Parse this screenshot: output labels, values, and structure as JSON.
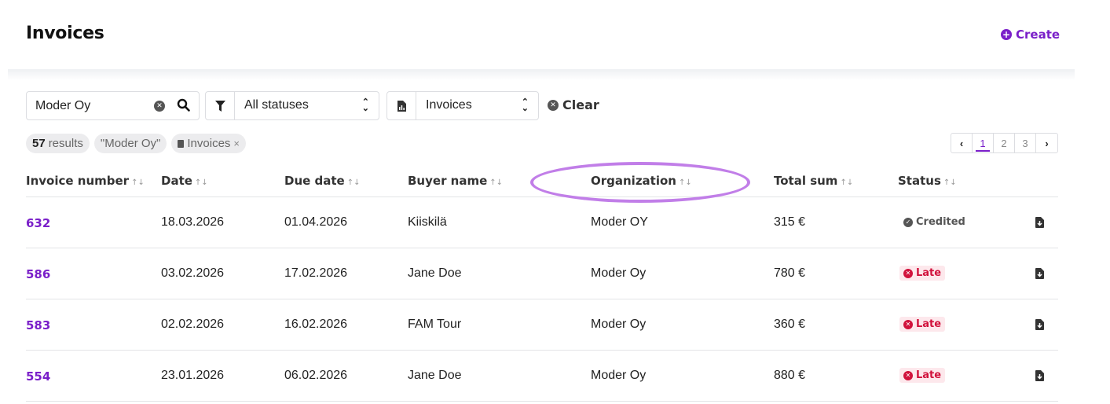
{
  "header": {
    "title": "Invoices",
    "create_label": "Create"
  },
  "search": {
    "value": "Moder Oy",
    "placeholder": ""
  },
  "filters": {
    "status_value": "All statuses",
    "type_value": "Invoices",
    "clear_label": "Clear"
  },
  "results": {
    "count": "57",
    "count_suffix": "results",
    "chip_query": "\"Moder Oy\"",
    "chip_type": "Invoices"
  },
  "pagination": {
    "prev": "‹",
    "pages": [
      "1",
      "2",
      "3"
    ],
    "next": "›",
    "active_page": "1"
  },
  "table": {
    "columns": [
      "Invoice number",
      "Date",
      "Due date",
      "Buyer name",
      "Organization",
      "Total sum",
      "Status"
    ],
    "rows": [
      {
        "number": "632",
        "date": "18.03.2026",
        "due": "01.04.2026",
        "buyer": "Kiiskilä",
        "org": "Moder OY",
        "total": "315 €",
        "status": "Credited"
      },
      {
        "number": "586",
        "date": "03.02.2026",
        "due": "17.02.2026",
        "buyer": "Jane Doe",
        "org": "Moder Oy",
        "total": "780 €",
        "status": "Late"
      },
      {
        "number": "583",
        "date": "02.02.2026",
        "due": "16.02.2026",
        "buyer": "FAM Tour",
        "org": "Moder Oy",
        "total": "360 €",
        "status": "Late"
      },
      {
        "number": "554",
        "date": "23.01.2026",
        "due": "06.02.2026",
        "buyer": "Jane Doe",
        "org": "Moder Oy",
        "total": "880 €",
        "status": "Late"
      }
    ]
  },
  "colors": {
    "accent": "#7a1fc9",
    "late": "#d1123c",
    "late_bg": "#fde8ec",
    "highlight": "#c17ee8"
  },
  "icons": {
    "create": "plus-circle-icon",
    "search": "search-icon",
    "clear": "close-circle-icon",
    "status": "filter-icon",
    "type": "document-chart-icon",
    "download": "download-icon",
    "credited": "check-circle-icon",
    "late": "close-circle-icon"
  }
}
